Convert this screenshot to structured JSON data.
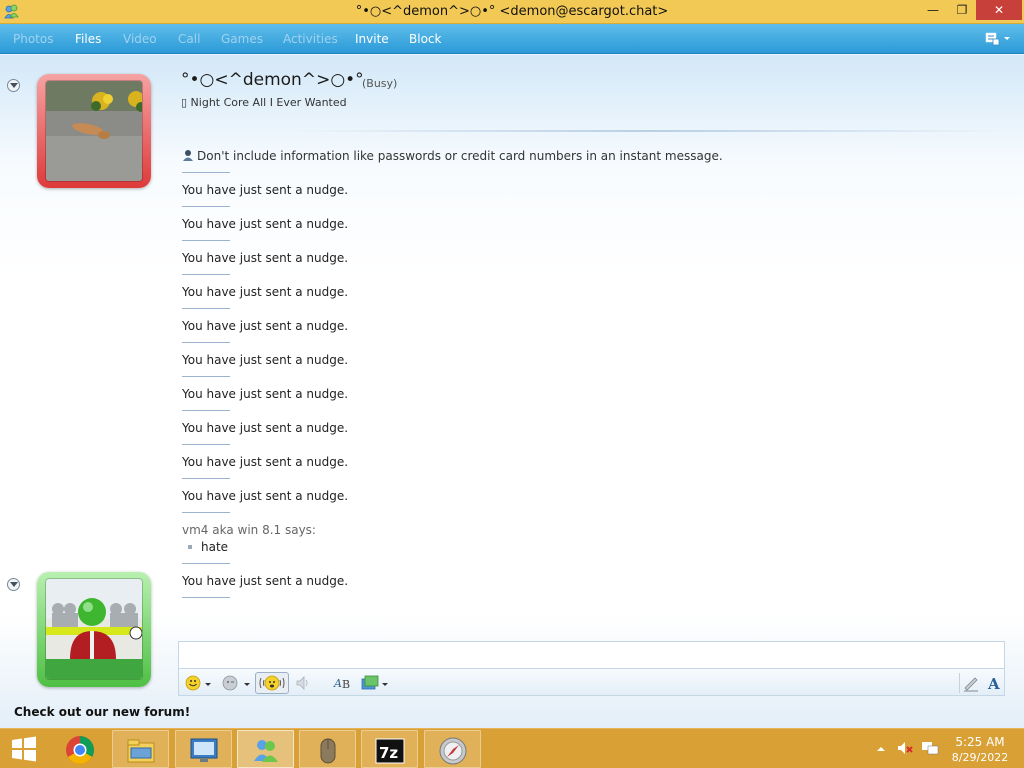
{
  "window": {
    "title": "°•○<^demon^>○•° <demon@escargot.chat>",
    "minimize": "—",
    "maximize": "❐",
    "close": "✕"
  },
  "menu": {
    "items": [
      {
        "label": "Photos",
        "enabled": false
      },
      {
        "label": "Files",
        "enabled": true
      },
      {
        "label": "Video",
        "enabled": false
      },
      {
        "label": "Call",
        "enabled": false
      },
      {
        "label": "Games",
        "enabled": false
      },
      {
        "label": "Activities",
        "enabled": false
      },
      {
        "label": "Invite",
        "enabled": true
      },
      {
        "label": "Block",
        "enabled": true
      }
    ]
  },
  "contact": {
    "name": "°•○<^demon^>○•°",
    "status": "(Busy)",
    "personal_message": "▯ Night Core All I Ever Wanted",
    "frame_color": "#de3a3a"
  },
  "conversation": {
    "warning": "Don't include information like passwords or credit card numbers in an instant message.",
    "nudges_before": [
      "You have just sent a nudge.",
      "You have just sent a nudge.",
      "You have just sent a nudge.",
      "You have just sent a nudge.",
      "You have just sent a nudge.",
      "You have just sent a nudge.",
      "You have just sent a nudge.",
      "You have just sent a nudge.",
      "You have just sent a nudge.",
      "You have just sent a nudge."
    ],
    "sender_line": "vm4 aka win 8.1 says:",
    "sender_message": "hate",
    "nudge_after": "You have just sent a nudge."
  },
  "self": {
    "frame_color": "#4ec044"
  },
  "toolbar": {
    "icons": [
      "emoticon-icon",
      "wink-icon",
      "nudge-icon",
      "voice-clip-icon",
      "font-icon",
      "background-icon",
      "handwriting-icon",
      "text-color-icon"
    ]
  },
  "footer": {
    "link": "Check out our new forum!"
  },
  "taskbar": {
    "apps": [
      "start-button",
      "chrome-icon",
      "file-explorer-icon",
      "remote-desktop-icon",
      "messenger-icon",
      "mouse-icon",
      "7zip-icon",
      "compass-icon"
    ],
    "clock_time": "5:25 AM",
    "clock_date": "8/29/2022",
    "accent": "#d9a035"
  }
}
